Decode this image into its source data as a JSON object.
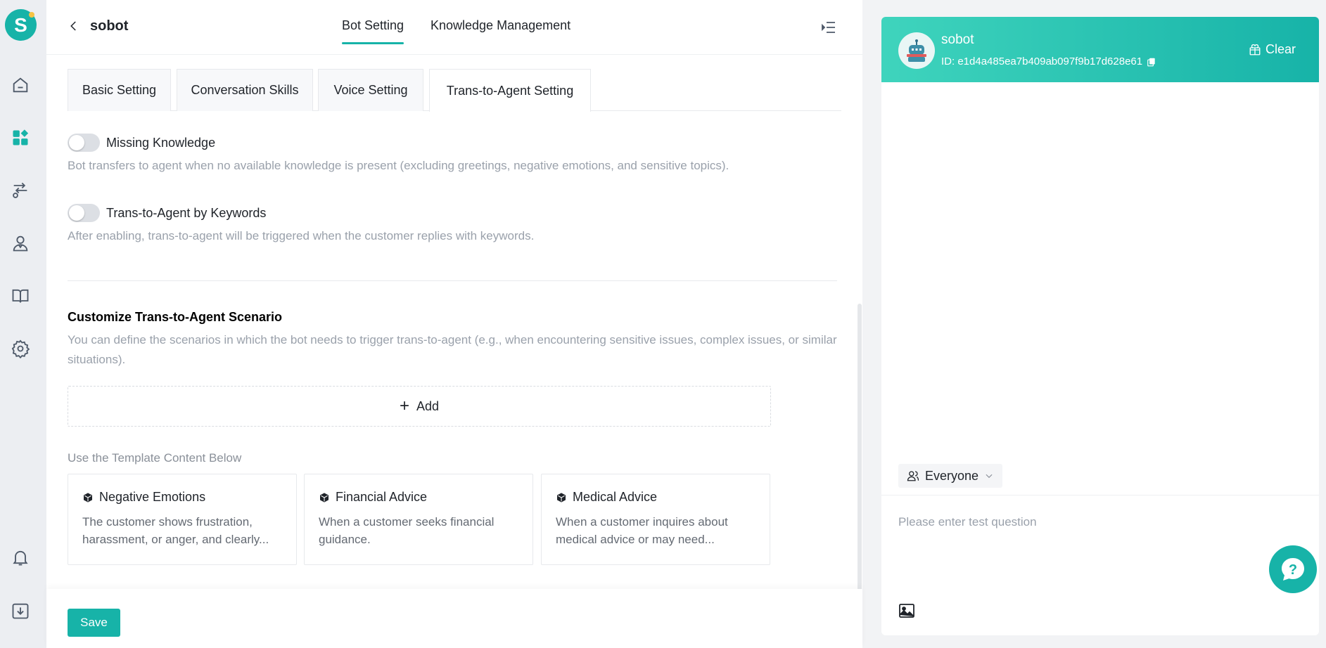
{
  "app": {
    "logo_letter": "S"
  },
  "sidebar": {
    "items": [
      {
        "name": "home",
        "icon": "home-icon"
      },
      {
        "name": "apps",
        "icon": "apps-icon"
      },
      {
        "name": "routes",
        "icon": "route-icon"
      },
      {
        "name": "agents",
        "icon": "agent-icon"
      },
      {
        "name": "knowledge",
        "icon": "book-icon"
      },
      {
        "name": "settings",
        "icon": "gear-icon"
      },
      {
        "name": "notifications",
        "icon": "bell-icon"
      },
      {
        "name": "downloads",
        "icon": "download-icon"
      }
    ]
  },
  "header": {
    "bot_name": "sobot",
    "nav": [
      {
        "label": "Bot Setting",
        "active": true
      },
      {
        "label": "Knowledge Management",
        "active": false
      }
    ]
  },
  "tabs": [
    {
      "label": "Basic Setting"
    },
    {
      "label": "Conversation Skills"
    },
    {
      "label": "Voice Setting"
    },
    {
      "label": "Trans-to-Agent Setting",
      "active": true
    }
  ],
  "settings": {
    "missing_knowledge": {
      "label": "Missing Knowledge",
      "enabled": false,
      "description": "Bot transfers to agent when no available knowledge is present (excluding greetings, negative emotions, and sensitive topics)."
    },
    "keywords": {
      "label": "Trans-to-Agent by Keywords",
      "enabled": false,
      "description": "After enabling, trans-to-agent will be triggered when the customer replies with keywords."
    }
  },
  "scenario": {
    "title": "Customize Trans-to-Agent Scenario",
    "description": "You can define the scenarios in which the bot needs to trigger trans-to-agent (e.g., when encountering sensitive issues, complex issues, or similar situations).",
    "add_label": "Add",
    "template_heading": "Use the Template Content Below",
    "templates": [
      {
        "title": "Negative Emotions",
        "description": "The customer shows frustration, harassment, or anger, and clearly..."
      },
      {
        "title": "Financial Advice",
        "description": "When a customer seeks financial guidance."
      },
      {
        "title": "Medical Advice",
        "description": "When a customer inquires about medical advice or may need..."
      }
    ]
  },
  "footer": {
    "save_label": "Save"
  },
  "test_panel": {
    "bot_name": "sobot",
    "bot_id": "ID: e1d4a485ea7b409ab097f9b17d628e61",
    "clear_label": "Clear",
    "audience": "Everyone",
    "input_placeholder": "Please enter test question"
  },
  "colors": {
    "accent": "#17b3a8",
    "header_gradient_start": "#3fd4bd",
    "muted_text": "#9aa1ab"
  }
}
